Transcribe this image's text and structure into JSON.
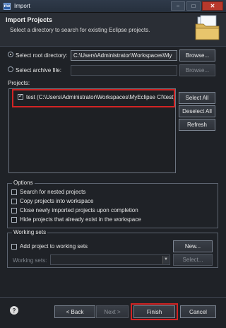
{
  "window": {
    "title": "Import",
    "app_icon_text": "me",
    "minimize": "−",
    "maximize": "□",
    "close": "✕"
  },
  "header": {
    "title": "Import Projects",
    "description": "Select a directory to search for existing Eclipse projects."
  },
  "source": {
    "root_label": "Select root directory:",
    "root_value": "C:\\Users\\Administrator\\Workspaces\\My",
    "root_browse": "Browse...",
    "archive_label": "Select archive file:",
    "archive_value": "",
    "archive_browse": "Browse..."
  },
  "projects": {
    "label": "Projects:",
    "items": [
      {
        "text": "test (C:\\Users\\Administrator\\Workspaces\\MyEclipse CI\\test)",
        "checked": true
      }
    ],
    "select_all": "Select All",
    "deselect_all": "Deselect All",
    "refresh": "Refresh"
  },
  "options": {
    "title": "Options",
    "items": [
      {
        "text": "Search for nested projects",
        "checked": false
      },
      {
        "text": "Copy projects into workspace",
        "checked": false
      },
      {
        "text": "Close newly imported projects upon completion",
        "checked": false
      },
      {
        "text": "Hide projects that already exist in the workspace",
        "checked": false
      }
    ]
  },
  "working_sets": {
    "title": "Working sets",
    "add_label": "Add project to working sets",
    "new_button": "New...",
    "sets_label": "Working sets:",
    "sets_value": "",
    "select_button": "Select..."
  },
  "footer": {
    "help": "?",
    "back": "< Back",
    "next": "Next >",
    "finish": "Finish",
    "cancel": "Cancel"
  }
}
